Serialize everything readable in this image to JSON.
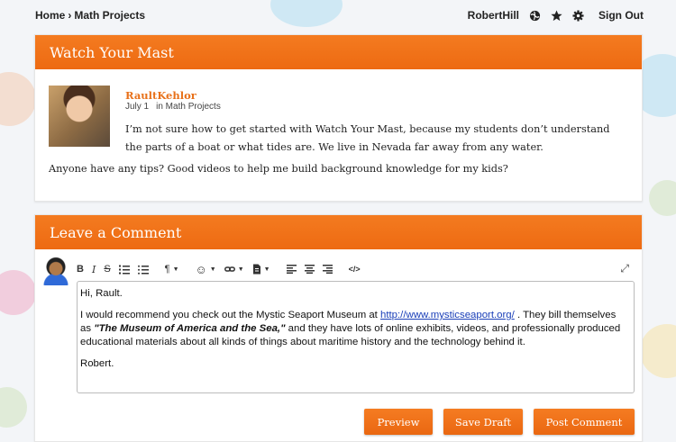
{
  "breadcrumb": {
    "home": "Home",
    "separator": "›",
    "current": "Math Projects"
  },
  "user": {
    "name": "RobertHill",
    "sign_out": "Sign Out"
  },
  "icons": {
    "globe": "globe-icon",
    "star": "star-icon",
    "gear": "gear-icon"
  },
  "post": {
    "title": "Watch Your Mast",
    "author": "RaultKehlor",
    "date": "July 1",
    "category": "in Math Projects",
    "paragraph1": "I’m not sure how to get started with Watch Your Mast, because my students don’t understand the parts of a boat or what tides are.  We live in Nevada far away from any water.",
    "paragraph2": "Anyone have any tips?  Good videos to help me build background knowledge for my kids?"
  },
  "comment": {
    "header": "Leave a Comment",
    "greeting": "Hi, Rault.",
    "body_before_link": "I would recommend you check out the Mystic Seaport Museum at ",
    "link": "http://www.mysticseaport.org/",
    "body_after_link": " .  They bill themselves as ",
    "emphasis": "\"The Museum of America and the Sea,\"",
    "body_end": " and they have lots of online exhibits, videos, and professionally produced educational materials about all kinds of things about maritime history and the technology behind it.",
    "signature": "Robert.",
    "buttons": {
      "preview": "Preview",
      "save_draft": "Save Draft",
      "post": "Post Comment"
    }
  },
  "toolbar": {
    "bold": "B",
    "italic": "I",
    "strike": "S",
    "paragraph": "¶",
    "emoji": "☺",
    "link": "🔗",
    "insert": "▤",
    "code": "</>",
    "expand": "⤢"
  },
  "colors": {
    "accent": "#f47b20",
    "link": "#1a3fb8",
    "author": "#e8711a"
  }
}
